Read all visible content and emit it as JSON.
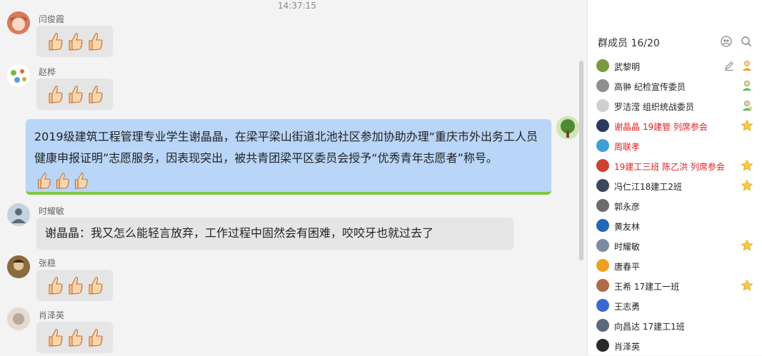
{
  "chat": {
    "timestamp": "14:37:15",
    "messages": [
      {
        "sender": "闫俊霞",
        "thumbs": 3
      },
      {
        "sender": "赵桦",
        "thumbs": 3
      },
      {
        "sender": "",
        "text": "2019级建筑工程管理专业学生谢晶晶，在梁平梁山街道北池社区参加协助办理“重庆市外出务工人员健康申报证明”志愿服务，因表现突出，被共青团梁平区委员会授予“优秀青年志愿者”称号。"
      },
      {
        "sender": "时耀敏",
        "text": "谢晶晶：我又怎么能轻言放弃，工作过程中固然会有困难，咬咬牙也就过去了"
      },
      {
        "sender": "张稳",
        "thumbs": 3
      },
      {
        "sender": "肖泽英",
        "thumbs": 3
      }
    ]
  },
  "sidepanel": {
    "title": "群成员 16/20",
    "members": [
      {
        "name": "武黎明",
        "red": false,
        "badge": "owner"
      },
      {
        "name": "高翀 纪检宣传委员",
        "red": false,
        "badge": "admin"
      },
      {
        "name": "罗洁滢 组织统战委员",
        "red": false,
        "badge": "admin-star"
      },
      {
        "name": "谢晶晶 19建管 列席参会",
        "red": true,
        "badge": "star"
      },
      {
        "name": "周联孝",
        "red": true,
        "badge": ""
      },
      {
        "name": "19建工三班 陈乙洪 列席参会",
        "red": true,
        "badge": "star"
      },
      {
        "name": "冯仁江18建工2班",
        "red": false,
        "badge": "star"
      },
      {
        "name": "郭永彦",
        "red": false,
        "badge": ""
      },
      {
        "name": "黄友林",
        "red": false,
        "badge": ""
      },
      {
        "name": "时耀敏",
        "red": false,
        "badge": "star"
      },
      {
        "name": "唐春平",
        "red": false,
        "badge": ""
      },
      {
        "name": "王希 17建工一班",
        "red": false,
        "badge": "star"
      },
      {
        "name": "王志勇",
        "red": false,
        "badge": ""
      },
      {
        "name": "向昌达 17建工1班",
        "red": false,
        "badge": ""
      },
      {
        "name": "肖泽英",
        "red": false,
        "badge": ""
      }
    ]
  },
  "colors": {
    "bubble": "#e5e5e5",
    "highlight_bubble": "#b9d5f7",
    "red_name": "#e02020",
    "star": "#f5b400"
  },
  "icons": {
    "thumbs": "thumbs-up-icon",
    "search": "search-icon",
    "members": "members-icon",
    "star": "star-icon",
    "edit": "edit-icon"
  }
}
